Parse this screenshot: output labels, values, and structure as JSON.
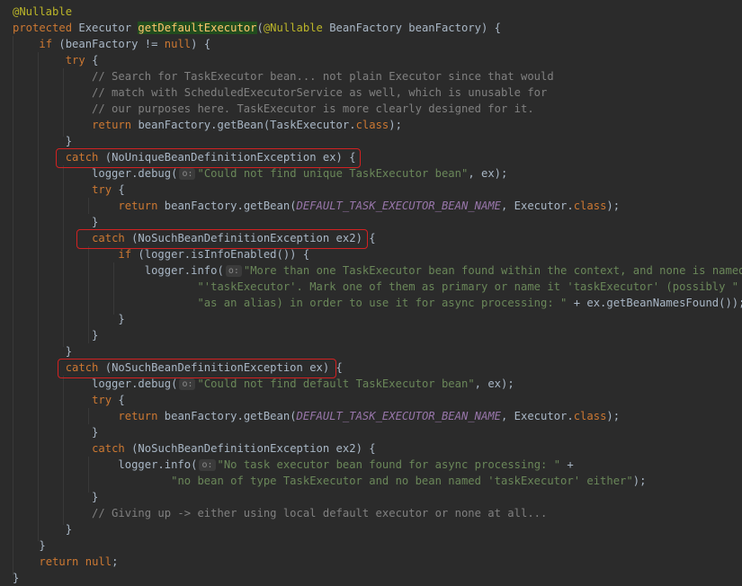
{
  "colors": {
    "background": "#2b2b2b",
    "default_text": "#a9b7c6",
    "keyword": "#cc7832",
    "annotation": "#bbb529",
    "method_declaration": "#ffc66d",
    "string": "#6a8759",
    "comment": "#808080",
    "constant_field": "#9876aa",
    "highlight_box": "#d32222"
  },
  "icons": {
    "parameter_hint": "parameter-hint-badge"
  },
  "code": {
    "lines": [
      [
        [
          "ann",
          "@Nullable"
        ]
      ],
      [
        [
          "kw",
          "protected "
        ],
        [
          "plain",
          "Executor "
        ],
        [
          "fn-hl",
          "getDefaultExecutor"
        ],
        [
          "plain",
          "("
        ],
        [
          "ann",
          "@Nullable "
        ],
        [
          "plain",
          "BeanFactory beanFactory) {"
        ]
      ],
      [
        [
          "plain",
          "    "
        ],
        [
          "kw",
          "if "
        ],
        [
          "plain",
          "(beanFactory != "
        ],
        [
          "kw",
          "null"
        ],
        [
          "plain",
          ") {"
        ]
      ],
      [
        [
          "plain",
          "        "
        ],
        [
          "kw",
          "try "
        ],
        [
          "plain",
          "{"
        ]
      ],
      [
        [
          "cmt",
          "            // Search for TaskExecutor bean... not plain Executor since that would"
        ]
      ],
      [
        [
          "cmt",
          "            // match with ScheduledExecutorService as well, which is unusable for"
        ]
      ],
      [
        [
          "cmt",
          "            // our purposes here. TaskExecutor is more clearly designed for it."
        ]
      ],
      [
        [
          "plain",
          "            "
        ],
        [
          "kw",
          "return "
        ],
        [
          "plain",
          "beanFactory.getBean(TaskExecutor."
        ],
        [
          "kw",
          "class"
        ],
        [
          "plain",
          ");"
        ]
      ],
      [
        [
          "plain",
          "        }"
        ]
      ],
      [
        [
          "plain",
          "        "
        ],
        [
          "kw",
          "catch "
        ],
        [
          "plain",
          "(NoUniqueBeanDefinitionException ex) {"
        ]
      ],
      [
        [
          "plain",
          "            logger.debug("
        ],
        [
          "hint",
          "o:"
        ],
        [
          "str",
          "\"Could not find unique TaskExecutor bean\""
        ],
        [
          "plain",
          ", ex);"
        ]
      ],
      [
        [
          "plain",
          "            "
        ],
        [
          "kw",
          "try "
        ],
        [
          "plain",
          "{"
        ]
      ],
      [
        [
          "plain",
          "                "
        ],
        [
          "kw",
          "return "
        ],
        [
          "plain",
          "beanFactory.getBean("
        ],
        [
          "const",
          "DEFAULT_TASK_EXECUTOR_BEAN_NAME"
        ],
        [
          "plain",
          ", Executor."
        ],
        [
          "kw",
          "class"
        ],
        [
          "plain",
          ");"
        ]
      ],
      [
        [
          "plain",
          "            }"
        ]
      ],
      [
        [
          "plain",
          "            "
        ],
        [
          "kw",
          "catch "
        ],
        [
          "plain",
          "(NoSuchBeanDefinitionException ex2) {"
        ]
      ],
      [
        [
          "plain",
          "                "
        ],
        [
          "kw",
          "if "
        ],
        [
          "plain",
          "(logger.isInfoEnabled()) {"
        ]
      ],
      [
        [
          "plain",
          "                    logger.info("
        ],
        [
          "hint",
          "o:"
        ],
        [
          "str",
          "\"More than one TaskExecutor bean found within the context, and none is named \""
        ],
        [
          "plain",
          " +"
        ]
      ],
      [
        [
          "plain",
          "                            "
        ],
        [
          "str",
          "\"'taskExecutor'. Mark one of them as primary or name it 'taskExecutor' (possibly \""
        ],
        [
          "plain",
          " +"
        ]
      ],
      [
        [
          "plain",
          "                            "
        ],
        [
          "str",
          "\"as an alias) in order to use it for async processing: \""
        ],
        [
          "plain",
          " + ex.getBeanNamesFound());"
        ]
      ],
      [
        [
          "plain",
          "                }"
        ]
      ],
      [
        [
          "plain",
          "            }"
        ]
      ],
      [
        [
          "plain",
          "        }"
        ]
      ],
      [
        [
          "plain",
          "        "
        ],
        [
          "kw",
          "catch "
        ],
        [
          "plain",
          "(NoSuchBeanDefinitionException ex) {"
        ]
      ],
      [
        [
          "plain",
          "            logger.debug("
        ],
        [
          "hint",
          "o:"
        ],
        [
          "str",
          "\"Could not find default TaskExecutor bean\""
        ],
        [
          "plain",
          ", ex);"
        ]
      ],
      [
        [
          "plain",
          "            "
        ],
        [
          "kw",
          "try "
        ],
        [
          "plain",
          "{"
        ]
      ],
      [
        [
          "plain",
          "                "
        ],
        [
          "kw",
          "return "
        ],
        [
          "plain",
          "beanFactory.getBean("
        ],
        [
          "const",
          "DEFAULT_TASK_EXECUTOR_BEAN_NAME"
        ],
        [
          "plain",
          ", Executor."
        ],
        [
          "kw",
          "class"
        ],
        [
          "plain",
          ");"
        ]
      ],
      [
        [
          "plain",
          "            }"
        ]
      ],
      [
        [
          "plain",
          "            "
        ],
        [
          "kw",
          "catch "
        ],
        [
          "plain",
          "(NoSuchBeanDefinitionException ex2) {"
        ]
      ],
      [
        [
          "plain",
          "                logger.info("
        ],
        [
          "hint",
          "o:"
        ],
        [
          "str",
          "\"No task executor bean found for async processing: \""
        ],
        [
          "plain",
          " +"
        ]
      ],
      [
        [
          "plain",
          "                        "
        ],
        [
          "str",
          "\"no bean of type TaskExecutor and no bean named 'taskExecutor' either\""
        ],
        [
          "plain",
          ");"
        ]
      ],
      [
        [
          "plain",
          "            }"
        ]
      ],
      [
        [
          "cmt",
          "            // Giving up -> either using local default executor or none at all..."
        ]
      ],
      [
        [
          "plain",
          "        }"
        ]
      ],
      [
        [
          "plain",
          "    }"
        ]
      ],
      [
        [
          "plain",
          "    "
        ],
        [
          "kw",
          "return "
        ],
        [
          "kw",
          "null"
        ],
        [
          "plain",
          ";"
        ]
      ],
      [
        [
          "plain",
          "}"
        ]
      ]
    ]
  }
}
